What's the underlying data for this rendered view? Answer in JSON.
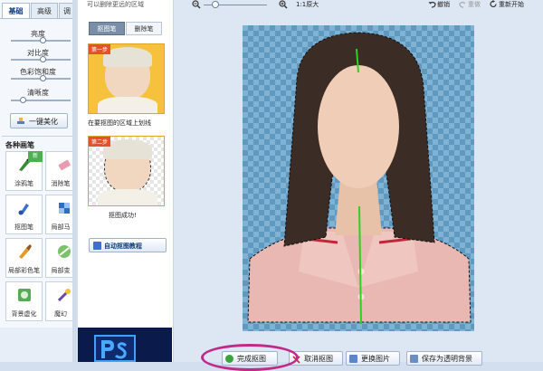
{
  "left_tabs": [
    "基础",
    "高级",
    "调"
  ],
  "sliders": [
    "亮度",
    "对比度",
    "色彩饱和度",
    "清晰度"
  ],
  "one_click_button": "一键美化",
  "section_title": "各种画笔",
  "tools": [
    "涂鸦笔",
    "消除笔",
    "抠图笔",
    "局部马",
    "局部彩色笔",
    "局部变",
    "背景虚化",
    "魔幻"
  ],
  "tool_badge": "新",
  "mid": {
    "top_hint": "可以删除更远的区域",
    "tabs": [
      "抠图笔",
      "删除笔"
    ],
    "step1_badge": "第一步",
    "step1_caption": "在要抠图的区域上划线",
    "step2_badge": "第二步",
    "step2_caption": "抠图成功!",
    "tutorial_button": "自动抠图教程"
  },
  "toolbar": {
    "zoom_label": "1:1原大",
    "undo": "撤销",
    "redo": "重做",
    "restart": "重新开始"
  },
  "bottom_buttons": {
    "finish": "完成抠图",
    "cancel": "取消抠图",
    "replace": "更换图片",
    "save_transparent": "保存为透明背景"
  },
  "colors": {
    "accent": "#0b3d78",
    "highlight_circle": "#c02a8a",
    "guide_line": "#2ad11f",
    "checker_a": "#7fb2d3",
    "checker_b": "#5f99c0"
  }
}
